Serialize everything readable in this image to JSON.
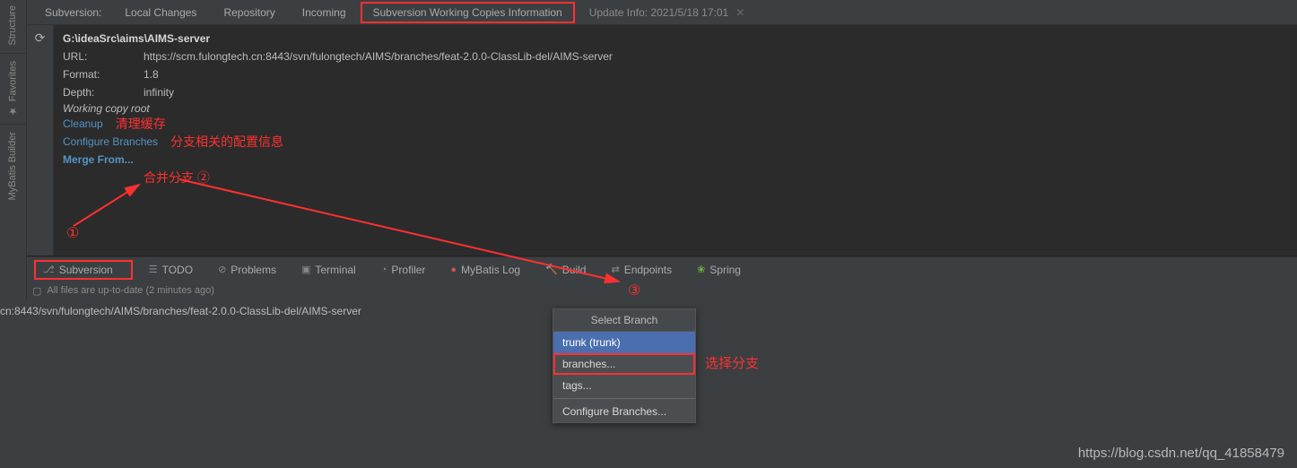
{
  "sidebar": {
    "structure": "Structure",
    "favorites": "Favorites",
    "mybatis": "MyBatis Builder"
  },
  "tabs": {
    "title": "Subversion:",
    "localChanges": "Local Changes",
    "repository": "Repository",
    "incoming": "Incoming",
    "svnInfo": "Subversion Working Copies Information",
    "updateInfo": "Update Info: 2021/5/18 17:01"
  },
  "workingCopy": {
    "path": "G:\\ideaSrc\\aims\\AIMS-server",
    "urlLabel": "URL:",
    "urlValue": "https://scm.fulongtech.cn:8443/svn/fulongtech/AIMS/branches/feat-2.0.0-ClassLib-del/AIMS-server",
    "formatLabel": "Format:",
    "formatValue": "1.8",
    "depthLabel": "Depth:",
    "depthValue": "infinity",
    "rootLabel": "Working copy root",
    "cleanup": "Cleanup",
    "configureBranches": "Configure Branches",
    "mergeFrom": "Merge From..."
  },
  "annotations": {
    "cleanup": "清理缓存",
    "configure": "分支相关的配置信息",
    "merge": "合并分支 ②",
    "one": "①",
    "three": "③",
    "selectBranch": "选择分支"
  },
  "bottomTabs": {
    "subversion": "Subversion",
    "todo": "TODO",
    "problems": "Problems",
    "terminal": "Terminal",
    "profiler": "Profiler",
    "mybatisLog": "MyBatis Log",
    "build": "Build",
    "endpoints": "Endpoints",
    "spring": "Spring"
  },
  "status": {
    "message": "All files are up-to-date (2 minutes ago)"
  },
  "pathLine": "cn:8443/svn/fulongtech/AIMS/branches/feat-2.0.0-ClassLib-del/AIMS-server",
  "popup": {
    "title": "Select Branch",
    "trunk": "trunk (trunk)",
    "branches": "branches...",
    "tags": "tags...",
    "configure": "Configure Branches..."
  },
  "watermark": "https://blog.csdn.net/qq_41858479"
}
